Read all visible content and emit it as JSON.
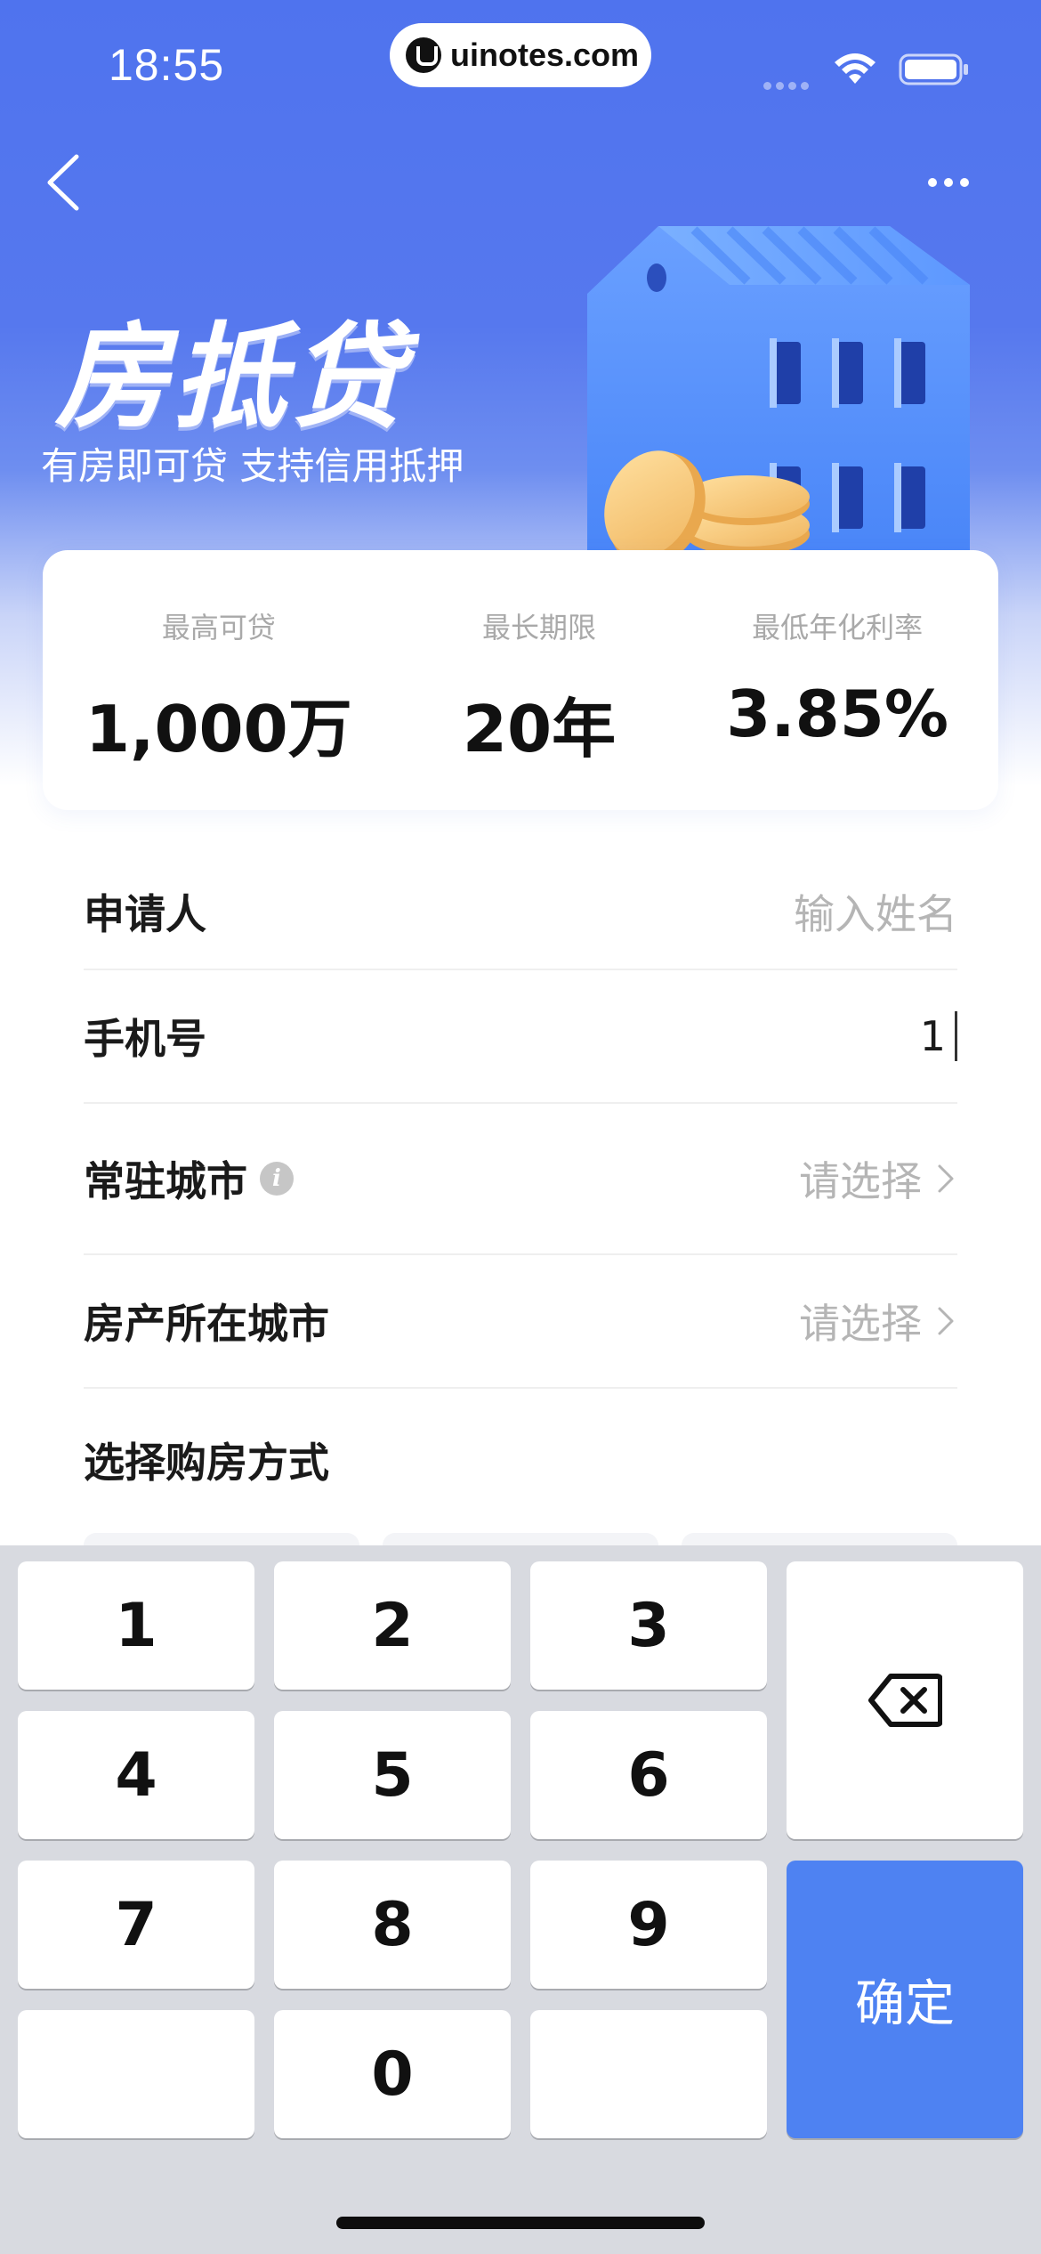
{
  "status_bar": {
    "time": "18:55",
    "site": "uinotes.com"
  },
  "hero": {
    "title": "房抵贷",
    "subtitle": "有房即可贷 支持信用抵押"
  },
  "stats": [
    {
      "label": "最高可贷",
      "value": "1,000万"
    },
    {
      "label": "最长期限",
      "value": "20年"
    },
    {
      "label": "最低年化利率",
      "value": "3.85%"
    }
  ],
  "form": {
    "applicant": {
      "label": "申请人",
      "placeholder": "输入姓名"
    },
    "phone": {
      "label": "手机号",
      "value": "1"
    },
    "city": {
      "label": "常驻城市",
      "value": "请选择"
    },
    "property_city": {
      "label": "房产所在城市",
      "value": "请选择"
    },
    "purchase_method": {
      "label": "选择购房方式"
    }
  },
  "keyboard": {
    "keys": [
      "1",
      "2",
      "3",
      "4",
      "5",
      "6",
      "7",
      "8",
      "9",
      "0"
    ],
    "confirm": "确定",
    "delete_icon": "backspace-icon"
  },
  "colors": {
    "brand_blue": "#4f73ee",
    "confirm_blue": "#4e82f2"
  }
}
